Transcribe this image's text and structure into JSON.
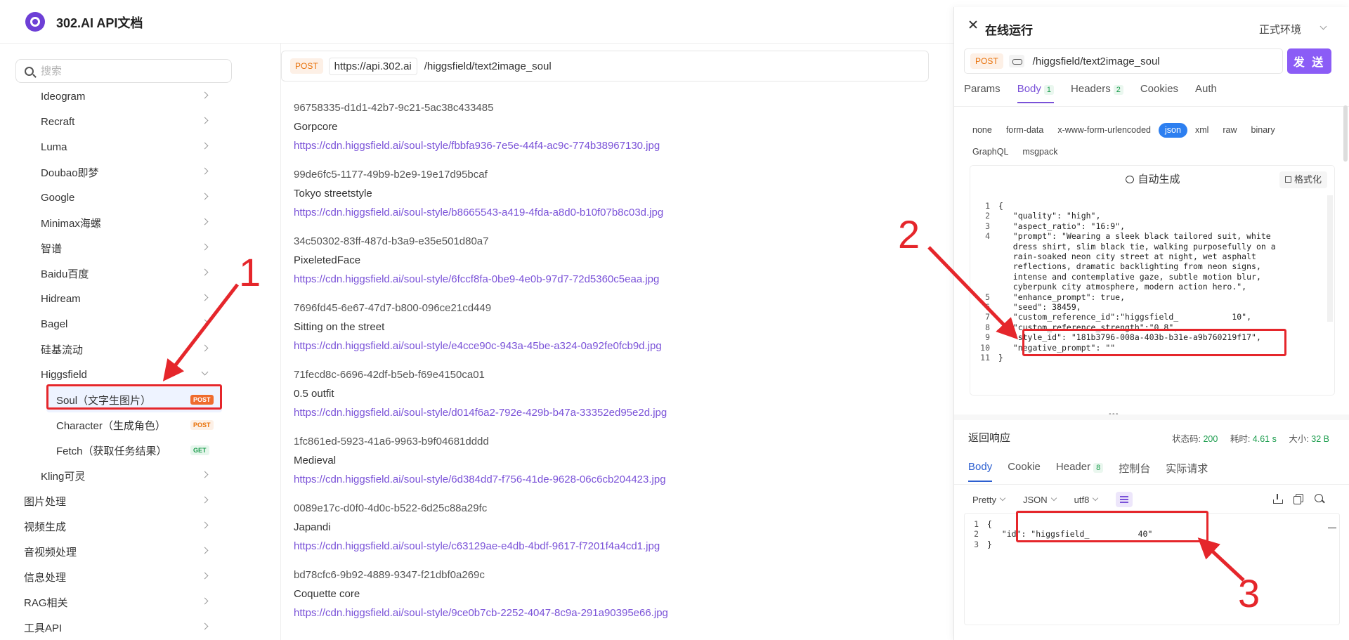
{
  "app": {
    "title": "302.AI API文档"
  },
  "sidebar": {
    "search_placeholder": "搜索",
    "items": [
      {
        "label": "Ideogram",
        "level": 1
      },
      {
        "label": "Recraft",
        "level": 1
      },
      {
        "label": "Luma",
        "level": 1
      },
      {
        "label": "Doubao即梦",
        "level": 1
      },
      {
        "label": "Google",
        "level": 1
      },
      {
        "label": "Minimax海螺",
        "level": 1
      },
      {
        "label": "智谱",
        "level": 1
      },
      {
        "label": "Baidu百度",
        "level": 1
      },
      {
        "label": "Hidream",
        "level": 1
      },
      {
        "label": "Bagel",
        "level": 1
      },
      {
        "label": "硅基流动",
        "level": 1
      },
      {
        "label": "Higgsfield",
        "level": 1,
        "expanded": true
      },
      {
        "label": "Soul（文字生图片）",
        "level": 2,
        "method": "POST",
        "active": true
      },
      {
        "label": "Character（生成角色）",
        "level": 2,
        "method": "POST"
      },
      {
        "label": "Fetch（获取任务结果）",
        "level": 2,
        "method": "GET"
      },
      {
        "label": "Kling可灵",
        "level": 1
      },
      {
        "label": "图片处理",
        "level": 0
      },
      {
        "label": "视频生成",
        "level": 0
      },
      {
        "label": "音视频处理",
        "level": 0
      },
      {
        "label": "信息处理",
        "level": 0
      },
      {
        "label": "RAG相关",
        "level": 0
      },
      {
        "label": "工具API",
        "level": 0
      }
    ]
  },
  "endpoint": {
    "method": "POST",
    "host": "https://api.302.ai",
    "path": "/higgsfield/text2image_soul"
  },
  "styles": [
    {
      "id": "96758335-d1d1-42b7-9c21-5ac38c433485",
      "name": "Gorpcore",
      "url": "https://cdn.higgsfield.ai/soul-style/fbbfa936-7e5e-44f4-ac9c-774b38967130.jpg"
    },
    {
      "id": "99de6fc5-1177-49b9-b2e9-19e17d95bcaf",
      "name": "Tokyo streetstyle",
      "url": "https://cdn.higgsfield.ai/soul-style/b8665543-a419-4fda-a8d0-b10f07b8c03d.jpg"
    },
    {
      "id": "34c50302-83ff-487d-b3a9-e35e501d80a7",
      "name": "PixeletedFace",
      "url": "https://cdn.higgsfield.ai/soul-style/6fccf8fa-0be9-4e0b-97d7-72d5360c5eaa.jpg"
    },
    {
      "id": "7696fd45-6e67-47d7-b800-096ce21cd449",
      "name": "Sitting on the street",
      "url": "https://cdn.higgsfield.ai/soul-style/e4cce90c-943a-45be-a324-0a92fe0fcb9d.jpg"
    },
    {
      "id": "71fecd8c-6696-42df-b5eb-f69e4150ca01",
      "name": "0.5 outfit",
      "url": "https://cdn.higgsfield.ai/soul-style/d014f6a2-792e-429b-b47a-33352ed95e2d.jpg"
    },
    {
      "id": "1fc861ed-5923-41a6-9963-b9f04681dddd",
      "name": "Medieval",
      "url": "https://cdn.higgsfield.ai/soul-style/6d384dd7-f756-41de-9628-06c6cb204423.jpg"
    },
    {
      "id": "0089e17c-d0f0-4d0c-b522-6d25c88a29fc",
      "name": "Japandi",
      "url": "https://cdn.higgsfield.ai/soul-style/c63129ae-e4db-4bdf-9617-f7201f4a4cd1.jpg"
    },
    {
      "id": "bd78cfc6-9b92-4889-9347-f21dbf0a269c",
      "name": "Coquette core",
      "url": "https://cdn.higgsfield.ai/soul-style/9ce0b7cb-2252-4047-8c9a-291a90395e66.jpg"
    }
  ],
  "panel": {
    "title": "在线运行",
    "env": "正式环境",
    "method": "POST",
    "path": "/higgsfield/text2image_soul",
    "send": "发 送",
    "tabs": [
      {
        "label": "Params"
      },
      {
        "label": "Body",
        "count": "1",
        "active": true
      },
      {
        "label": "Headers",
        "count": "2"
      },
      {
        "label": "Cookies"
      },
      {
        "label": "Auth"
      }
    ],
    "body_types": [
      "none",
      "form-data",
      "x-www-form-urlencoded",
      "json",
      "xml",
      "raw",
      "binary",
      "GraphQL",
      "msgpack"
    ],
    "body_type_active": "json",
    "auto_generate": "自动生成",
    "format_btn": "格式化",
    "code_lines": [
      {
        "n": "1",
        "t": "{"
      },
      {
        "n": "2",
        "t": "   \"quality\": \"high\","
      },
      {
        "n": "3",
        "t": "   \"aspect_ratio\": \"16:9\","
      },
      {
        "n": "4",
        "t": "   \"prompt\": \"Wearing a sleek black tailored suit, white"
      },
      {
        "n": "",
        "t": "   dress shirt, slim black tie, walking purposefully on a"
      },
      {
        "n": "",
        "t": "   rain-soaked neon city street at night, wet asphalt"
      },
      {
        "n": "",
        "t": "   reflections, dramatic backlighting from neon signs,"
      },
      {
        "n": "",
        "t": "   intense and contemplative gaze, subtle motion blur,"
      },
      {
        "n": "",
        "t": "   cyberpunk city atmosphere, modern action hero.\","
      },
      {
        "n": "5",
        "t": "   \"enhance_prompt\": true,"
      },
      {
        "n": "6",
        "t": "   \"seed\": 38459,"
      },
      {
        "n": "7",
        "t": "   \"custom_reference_id\":\"higgsfield_           10\","
      },
      {
        "n": "8",
        "t": "   \"custom_reference_strength\":\"0.8\","
      },
      {
        "n": "9",
        "t": "   \"style_id\": \"181b3796-008a-403b-b31e-a9b760219f17\","
      },
      {
        "n": "10",
        "t": "   \"negative_prompt\": \"\""
      },
      {
        "n": "11",
        "t": "}"
      }
    ],
    "response": {
      "title": "返回响应",
      "status_label": "状态码:",
      "status": "200",
      "time_label": "耗时:",
      "time": "4.61 s",
      "size_label": "大小:",
      "size": "32 B",
      "tabs": [
        {
          "label": "Body",
          "active": true
        },
        {
          "label": "Cookie"
        },
        {
          "label": "Header",
          "count": "8"
        },
        {
          "label": "控制台"
        },
        {
          "label": "实际请求"
        }
      ],
      "options": [
        "Pretty",
        "JSON",
        "utf8"
      ],
      "lines": [
        {
          "n": "1",
          "t": "{"
        },
        {
          "n": "2",
          "t": "   \"id\": \"higgsfield_          40\""
        },
        {
          "n": "3",
          "t": "}"
        }
      ]
    }
  },
  "annotations": [
    "1",
    "2",
    "3"
  ],
  "colors": {
    "accent": "#8b5cf6",
    "link": "#7a52d8",
    "annotation": "#e5262b"
  }
}
